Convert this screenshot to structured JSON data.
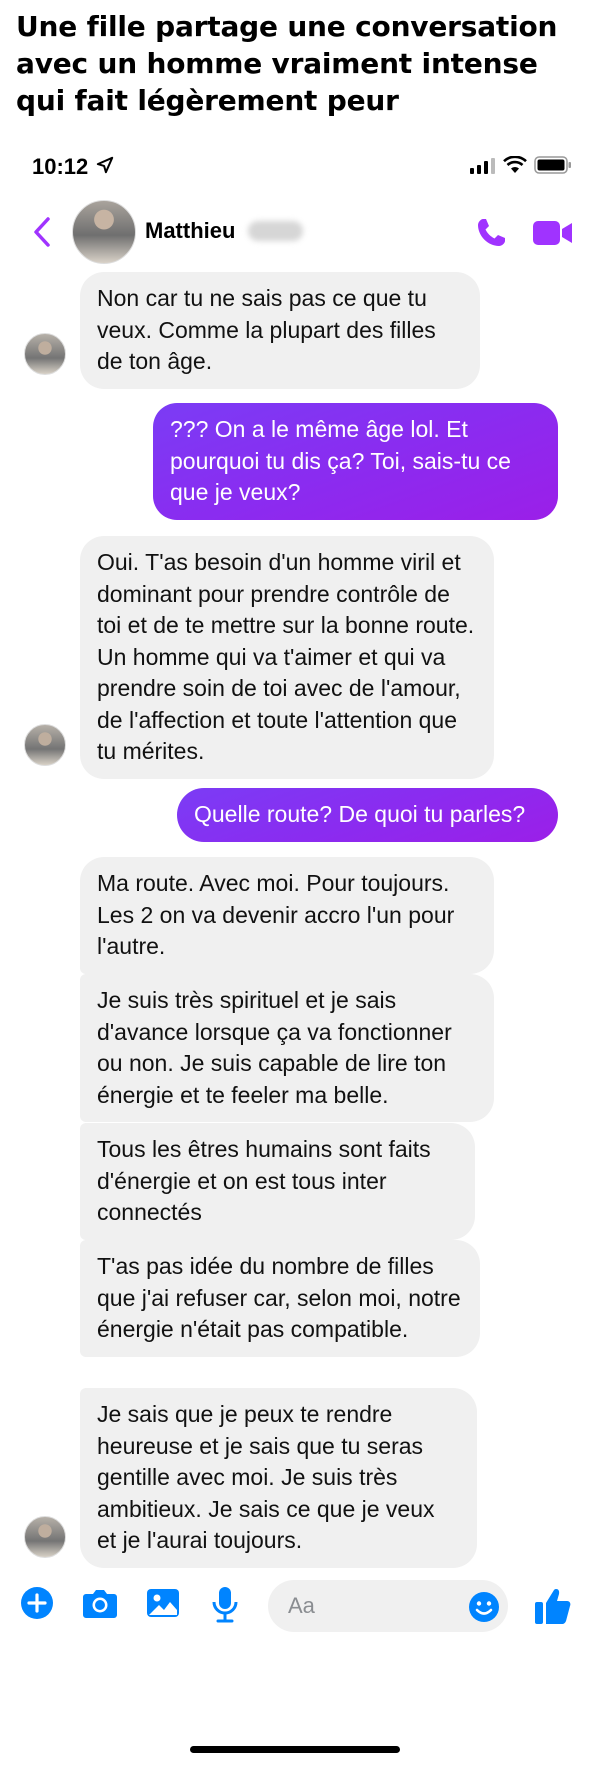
{
  "caption": "Une fille partage une conversation avec un homme vraiment intense qui fait légèrement peur",
  "status_bar": {
    "time": "10:12",
    "icons": [
      "location-arrow-icon",
      "signal-icon",
      "wifi-icon",
      "battery-icon"
    ]
  },
  "header": {
    "contact_name": "Matthieu",
    "back_icon": "chevron-left-icon",
    "call_icon": "phone-icon",
    "video_icon": "video-camera-icon"
  },
  "colors": {
    "accent": "#a033ff",
    "outgoing_bubble": "#8a2cf0",
    "incoming_bubble": "#f0f0f0",
    "composer_icons": "#0084ff"
  },
  "messages": [
    {
      "sender": "them",
      "text": "Non car tu ne sais pas ce que tu veux. Comme la plupart des filles de ton âge."
    },
    {
      "sender": "me",
      "text": "??? On a le même âge lol. Et pourquoi tu dis ça? Toi, sais-tu ce que je veux?"
    },
    {
      "sender": "them",
      "text": "Oui. T'as besoin d'un homme viril et dominant pour prendre contrôle de toi et de te mettre sur la bonne route. Un homme qui va t'aimer et qui va prendre soin de toi avec de l'amour, de l'affection et toute l'attention que tu mérites."
    },
    {
      "sender": "me",
      "text": "Quelle route? De quoi tu parles?"
    },
    {
      "sender": "them",
      "text": "Ma route. Avec moi. Pour toujours. Les 2 on va devenir accro l'un pour l'autre."
    },
    {
      "sender": "them",
      "text": "Je suis très spirituel et je sais d'avance lorsque ça va fonctionner ou non. Je suis capable de lire ton énergie et te feeler ma belle."
    },
    {
      "sender": "them",
      "text": "Tous les êtres humains sont faits d'énergie et on est tous inter connectés"
    },
    {
      "sender": "them",
      "text": "T'as pas idée du nombre de filles que j'ai refuser car, selon moi, notre énergie n'était pas compatible."
    },
    {
      "sender": "them",
      "text": "Je sais que je peux te rendre heureuse et je sais que tu seras gentille avec moi. Je suis très ambitieux. Je sais ce que je veux et je l'aurai toujours."
    }
  ],
  "composer": {
    "placeholder": "Aa",
    "icons": [
      "plus-circle-icon",
      "camera-icon",
      "image-icon",
      "microphone-icon",
      "emoji-icon",
      "thumbs-up-icon"
    ]
  }
}
